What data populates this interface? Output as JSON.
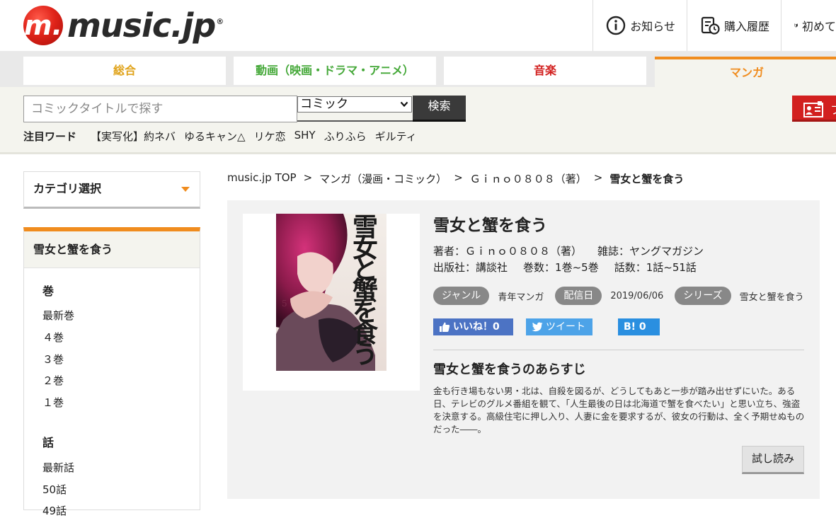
{
  "header": {
    "logo_mark": "m.",
    "logo_text": "music.jp",
    "logo_reg": "®",
    "nav": [
      {
        "label": "お知らせ",
        "icon": "info-icon"
      },
      {
        "label": "購入履歴",
        "icon": "history-icon"
      },
      {
        "label": "初めて",
        "icon": "beginner-icon"
      }
    ]
  },
  "tabs": {
    "sogo": "総合",
    "video": "動画（映画・ドラマ・アニメ）",
    "music": "音楽",
    "manga": "マンガ"
  },
  "search": {
    "placeholder": "コミックタイトルで探す",
    "select_value": "コミック",
    "button": "検索",
    "red_button_text": "フ"
  },
  "hot_words": {
    "label": "注目ワード",
    "words": [
      "【実写化】約ネバ",
      "ゆるキャン△",
      "リケ恋",
      "SHY",
      "ふりふら",
      "ギルティ"
    ]
  },
  "sidebar": {
    "category_select": "カテゴリ選択",
    "title": "雪女と蟹を食う",
    "volumes_header": "巻",
    "volumes": [
      "最新巻",
      "４巻",
      "３巻",
      "２巻",
      "１巻"
    ],
    "episodes_header": "話",
    "episodes": [
      "最新話",
      "50話",
      "49話"
    ]
  },
  "breadcrumb": {
    "items": [
      "music.jp TOP",
      "マンガ（漫画・コミック）",
      "Ｇｉｎｏ０８０８（著）"
    ],
    "separator": ">",
    "current": "雪女と蟹を食う"
  },
  "detail": {
    "title": "雪女と蟹を食う",
    "author_label": "著者：",
    "author": "Ｇｉｎｏ０８０８（著）",
    "magazine_label": "雑誌：",
    "magazine": "ヤングマガジン",
    "publisher_label": "出版社：",
    "publisher": "講談社",
    "volumes_label": "巻数：",
    "volumes": "1巻~5巻",
    "episodes_label": "話数：",
    "episodes": "1話~51話",
    "tags": [
      {
        "label": "ジャンル",
        "value": "青年マンガ"
      },
      {
        "label": "配信日",
        "value": "2019/06/06"
      },
      {
        "label": "シリーズ",
        "value": "雪女と蟹を食う"
      }
    ],
    "like_label": "いいね！0",
    "tweet_label": "ツイート",
    "hatena_label": "B! 0",
    "synopsis_title": "雪女と蟹を食うのあらすじ",
    "synopsis": "金も行き場もない男・北は、自殺を図るが、どうしてもあと一歩が踏み出せずにいた。ある日、テレビのグルメ番組を観て、「人生最後の日は北海道で蟹を食べたい」と思い立ち、強盗を決意する。高級住宅に押し入り、人妻に金を要求するが、彼女の行動は、全く予期せぬものだった――。",
    "try_read": "試し読み",
    "cover_number": "5",
    "cover_title_chars": [
      "雪",
      "女",
      "と",
      "蟹",
      "を",
      "食",
      "う"
    ]
  },
  "colors": {
    "manga_accent": "#f08c1e",
    "music_red": "#d2201f",
    "video_green": "#44a838",
    "sogo_gold": "#e0a31a",
    "facebook": "#4c73c4",
    "twitter": "#4da3e8",
    "hatena": "#2a8fe0"
  }
}
